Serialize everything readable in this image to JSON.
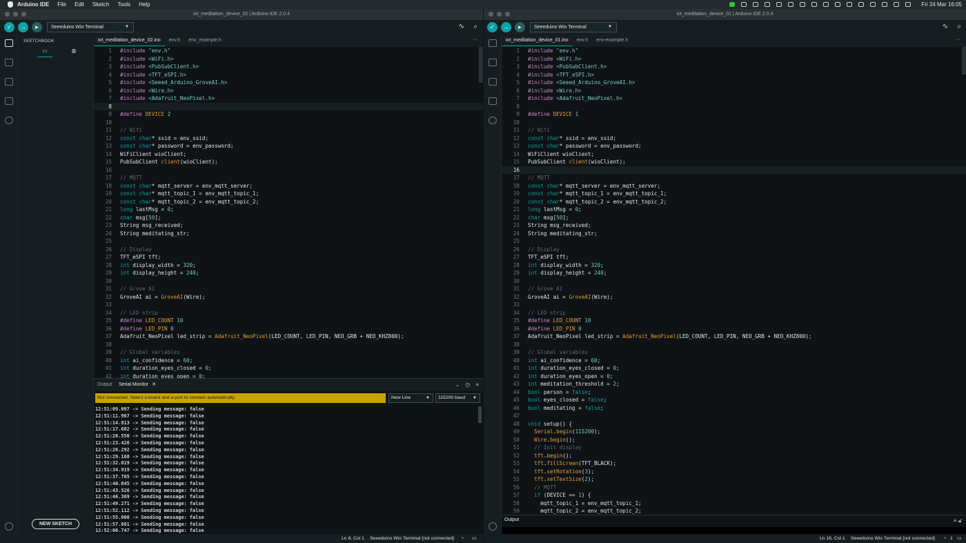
{
  "menubar": {
    "app_name": "Arduino IDE",
    "menus": [
      "File",
      "Edit",
      "Sketch",
      "Tools",
      "Help"
    ],
    "clock": "Fri 24 Mar  16:05"
  },
  "window_left": {
    "title": "iot_meditation_device_02 | Arduino IDE 2.0.4",
    "board": "Seeeduino Wio Terminal",
    "sketchbook_label": "SKETCHBOOK",
    "new_sketch_label": "NEW SKETCH",
    "tabs": [
      "iot_meditation_device_02.ino",
      "env.h",
      "env_example.h"
    ],
    "active_tab": 0,
    "current_line": 8,
    "code_lines": [
      "#include \"env.h\"",
      "#include <WiFi.h>",
      "#include <PubSubClient.h>",
      "#include <TFT_eSPI.h>",
      "#include <Seeed_Arduino_GroveAI.h>",
      "#include <Wire.h>",
      "#include <Adafruit_NeoPixel.h>",
      "",
      "#define DEVICE 2",
      "",
      "// Wifi",
      "const char* ssid = env_ssid;",
      "const char* password = env_password;",
      "WiFiClient wioClient;",
      "PubSubClient client(wioClient);",
      "",
      "// MQTT",
      "const char* mqtt_server = env_mqtt_server;",
      "const char* mqtt_topic_1 = env_mqtt_topic_1;",
      "const char* mqtt_topic_2 = env_mqtt_topic_2;",
      "long lastMsg = 0;",
      "char msg[50];",
      "String msg_received;",
      "String meditating_str;",
      "",
      "// Display",
      "TFT_eSPI tft;",
      "int display_width = 320;",
      "int display_height = 240;",
      "",
      "// Grove AI",
      "GroveAI ai = GroveAI(Wire);",
      "",
      "// LED strip",
      "#define LED_COUNT 10",
      "#define LED_PIN 0",
      "Adafruit_NeoPixel led_strip = Adafruit_NeoPixel(LED_COUNT, LED_PIN, NEO_GRB + NEO_KHZ800);",
      "",
      "// Global variables",
      "int ai_confidence = 60;",
      "int duration_eyes_closed = 0;",
      "int duration_eyes_open = 0;"
    ],
    "panel_tabs": [
      "Output",
      "Serial Monitor"
    ],
    "active_panel_tab": 1,
    "serial_warning": "Not connected. Select a board and a port to connect automatically.",
    "line_ending": "New Line",
    "baud": "115200 baud",
    "serial_lines": [
      "12:51:09.097 -> Sending message: false",
      "12:51:11.967 -> Sending message: false",
      "12:51:14.813 -> Sending message: false",
      "12:51:17.682 -> Sending message: false",
      "12:51:20.550 -> Sending message: false",
      "12:51:23.426 -> Sending message: false",
      "12:51:26.292 -> Sending message: false",
      "12:51:29.168 -> Sending message: false",
      "12:51:32.019 -> Sending message: false",
      "12:51:34.919 -> Sending message: false",
      "12:51:37.765 -> Sending message: false",
      "12:51:40.645 -> Sending message: false",
      "12:51:43.526 -> Sending message: false",
      "12:51:46.369 -> Sending message: false",
      "12:51:49.271 -> Sending message: false",
      "12:51:52.112 -> Sending message: false",
      "12:51:55.000 -> Sending message: false",
      "12:51:57.861 -> Sending message: false",
      "12:52:00.747 -> Sending message: false"
    ],
    "status_position": "Ln 8, Col 1",
    "status_board": "Seeeduino Wio Terminal [not connected]"
  },
  "window_right": {
    "title": "iot_meditation_device_01 | Arduino IDE 2.0.4",
    "board": "Seeeduino Wio Terminal",
    "tabs": [
      "iot_meditation_device_01.ino",
      "env.h",
      "env-example.h"
    ],
    "active_tab": 0,
    "current_line": 16,
    "code_lines": [
      "#include \"env.h\"",
      "#include <WiFi.h>",
      "#include <PubSubClient.h>",
      "#include <TFT_eSPI.h>",
      "#include <Seeed_Arduino_GroveAI.h>",
      "#include <Wire.h>",
      "#include <Adafruit_NeoPixel.h>",
      "",
      "#define DEVICE 1",
      "",
      "// Wifi",
      "const char* ssid = env_ssid;",
      "const char* password = env_password;",
      "WiFiClient wioClient;",
      "PubSubClient client(wioClient);",
      "",
      "// MQTT",
      "const char* mqtt_server = env_mqtt_server;",
      "const char* mqtt_topic_1 = env_mqtt_topic_1;",
      "const char* mqtt_topic_2 = env_mqtt_topic_2;",
      "long lastMsg = 0;",
      "char msg[50];",
      "String msg_received;",
      "String meditating_str;",
      "",
      "// Display",
      "TFT_eSPI tft;",
      "int display_width = 320;",
      "int display_height = 240;",
      "",
      "// Grove AI",
      "GroveAI ai = GroveAI(Wire);",
      "",
      "// LED strip",
      "#define LED_COUNT 10",
      "#define LED_PIN 0",
      "Adafruit_NeoPixel led_strip = Adafruit_NeoPixel(LED_COUNT, LED_PIN, NEO_GRB + NEO_KHZ800);",
      "",
      "// Global variables",
      "int ai_confidence = 60;",
      "int duration_eyes_closed = 0;",
      "int duration_eyes_open = 0;",
      "int meditation_threshold = 2;",
      "bool person = false;",
      "bool eyes_closed = false;",
      "bool meditating = false;",
      "",
      "void setup() {",
      "  Serial.begin(115200);",
      "  Wire.begin();",
      "  // Init display",
      "  tft.begin();",
      "  tft.fillScreen(TFT_BLACK);",
      "  tft.setRotation(3);",
      "  tft.setTextSize(2);",
      "  // MQTT",
      "  if (DEVICE == 1) {",
      "    mqtt_topic_1 = env_mqtt_topic_1;",
      "    mqtt_topic_2 = env_mqtt_topic_2;"
    ],
    "panel_tabs": [
      "Output"
    ],
    "status_position": "Ln 16, Col 1",
    "status_board": "Seeeduino Wio Terminal [not connected]",
    "status_count": "1"
  },
  "colors": {
    "accent": "#0ca1a6",
    "warning": "#c9a400",
    "editor_bg": "#0f1316",
    "chrome_bg": "#171e21"
  },
  "icons": [
    "apple-icon",
    "verify-icon",
    "upload-icon",
    "debug-icon",
    "serial-plotter-icon",
    "serial-monitor-icon",
    "folder-icon",
    "boards-icon",
    "library-icon",
    "debug-side-icon",
    "search-icon",
    "account-icon"
  ]
}
